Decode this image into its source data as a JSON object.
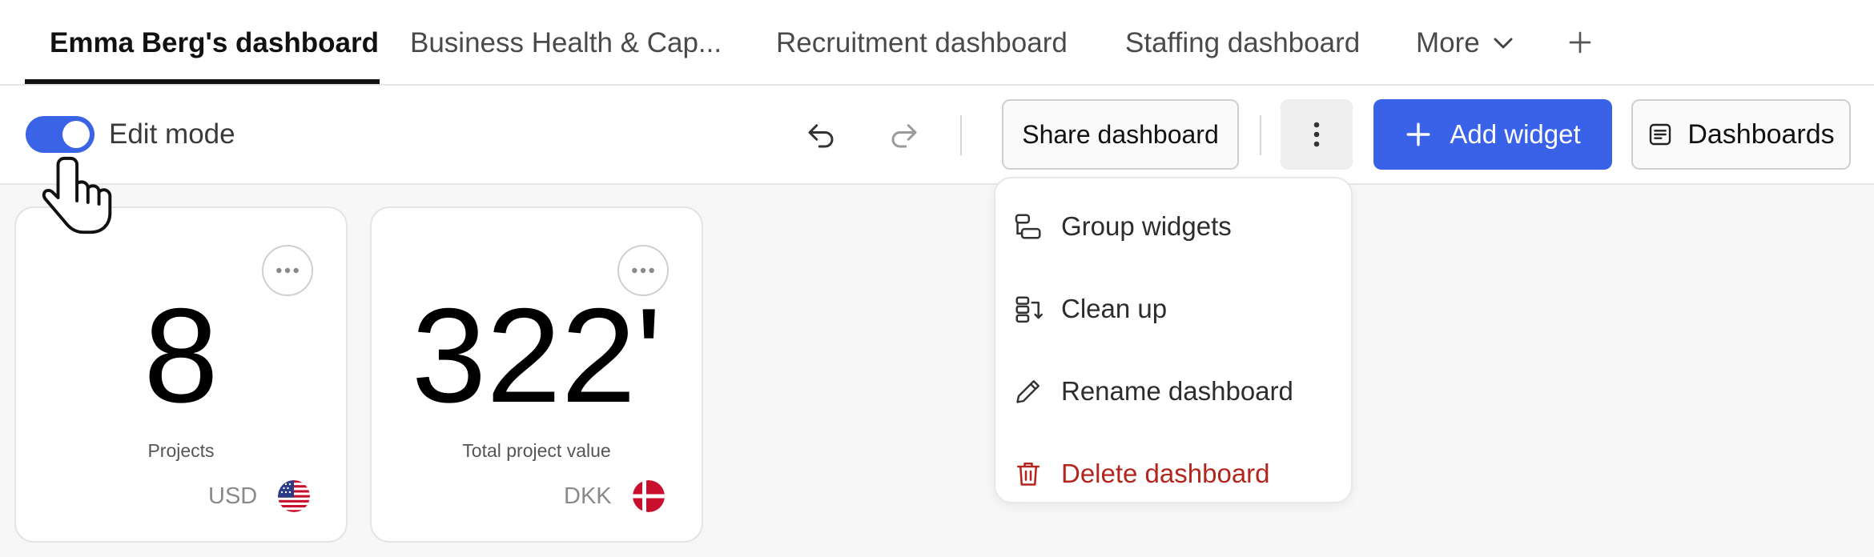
{
  "tabs": [
    {
      "label": "Emma Berg's dashboard",
      "active": true
    },
    {
      "label": "Business Health & Cap...",
      "active": false
    },
    {
      "label": "Recruitment dashboard",
      "active": false
    },
    {
      "label": "Staffing dashboard",
      "active": false
    },
    {
      "label": "More",
      "active": false
    }
  ],
  "toolbar": {
    "edit_mode_label": "Edit mode",
    "edit_mode_on": true,
    "share_label": "Share dashboard",
    "add_widget_label": "Add widget",
    "dashboards_label": "Dashboards"
  },
  "menu": {
    "items": [
      {
        "label": "Group widgets",
        "icon": "group-widgets-icon"
      },
      {
        "label": "Clean up",
        "icon": "clean-up-icon"
      },
      {
        "label": "Rename dashboard",
        "icon": "pencil-icon"
      },
      {
        "label": "Delete dashboard",
        "icon": "trash-icon",
        "danger": true
      }
    ]
  },
  "widgets": [
    {
      "value": "8",
      "label": "Projects",
      "currency": "USD",
      "flag": "us-flag-icon"
    },
    {
      "value": "322'",
      "label": "Total project value",
      "currency": "DKK",
      "flag": "dk-flag-icon"
    }
  ],
  "colors": {
    "accent": "#3a62e8",
    "danger": "#b3261e",
    "background": "#f7f7f7"
  }
}
